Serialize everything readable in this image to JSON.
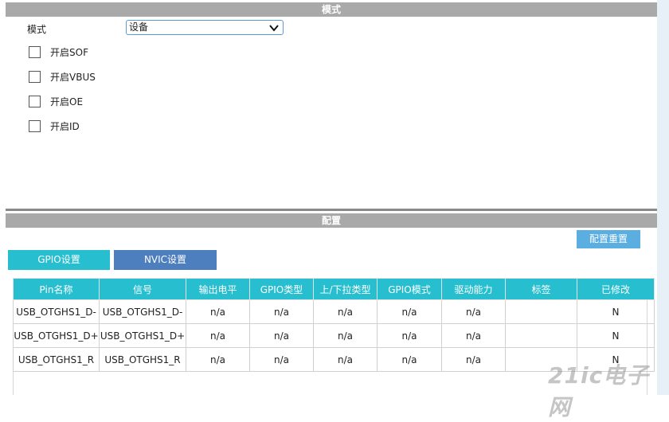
{
  "mode_section": {
    "header": "模式",
    "mode_label": "模式",
    "mode_value": "设备",
    "checkboxes": [
      {
        "label": "开启SOF",
        "checked": false
      },
      {
        "label": "开启VBUS",
        "checked": false
      },
      {
        "label": "开启OE",
        "checked": false
      },
      {
        "label": "开启ID",
        "checked": false
      }
    ]
  },
  "config_section": {
    "header": "配置",
    "reset_button": "配置重置",
    "tabs": [
      {
        "label": "GPIO设置",
        "active": true
      },
      {
        "label": "NVIC设置",
        "active": false
      }
    ],
    "table": {
      "headers": [
        "Pin名称",
        "信号",
        "输出电平",
        "GPIO类型",
        "上/下拉类型",
        "GPIO模式",
        "驱动能力",
        "标签",
        "已修改"
      ],
      "rows": [
        [
          "USB_OTGHS1_D-",
          "USB_OTGHS1_D-",
          "n/a",
          "n/a",
          "n/a",
          "n/a",
          "n/a",
          "",
          "N"
        ],
        [
          "USB_OTGHS1_D+",
          "USB_OTGHS1_D+",
          "n/a",
          "n/a",
          "n/a",
          "n/a",
          "n/a",
          "",
          "N"
        ],
        [
          "USB_OTGHS1_R",
          "USB_OTGHS1_R",
          "n/a",
          "n/a",
          "n/a",
          "n/a",
          "n/a",
          "",
          "N"
        ]
      ]
    }
  },
  "watermark": "21ic电子网",
  "colors": {
    "header_gray": "#a9a9a9",
    "accent_teal": "#27bfd0",
    "tab_blue": "#4d7fbf",
    "button_blue": "#5aaee0"
  }
}
